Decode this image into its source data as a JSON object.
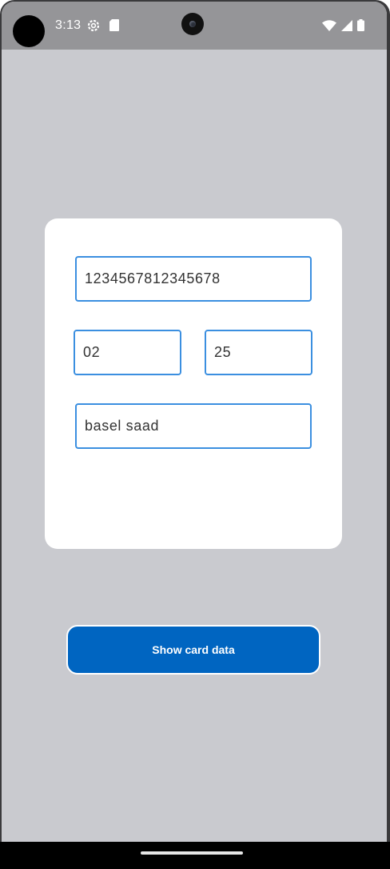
{
  "status_bar": {
    "time": "3:13",
    "icons": [
      "settings-icon",
      "sd-card-icon",
      "wifi-icon",
      "signal-icon",
      "battery-icon"
    ]
  },
  "card_form": {
    "card_number": "1234567812345678",
    "expiry_month": "02",
    "expiry_year": "25",
    "card_holder": "basel saad"
  },
  "actions": {
    "show_button_label": "Show card data"
  },
  "colors": {
    "background": "#c9cacf",
    "status_bar": "#959598",
    "field_border": "#3b8fe0",
    "button": "#0065c1"
  }
}
